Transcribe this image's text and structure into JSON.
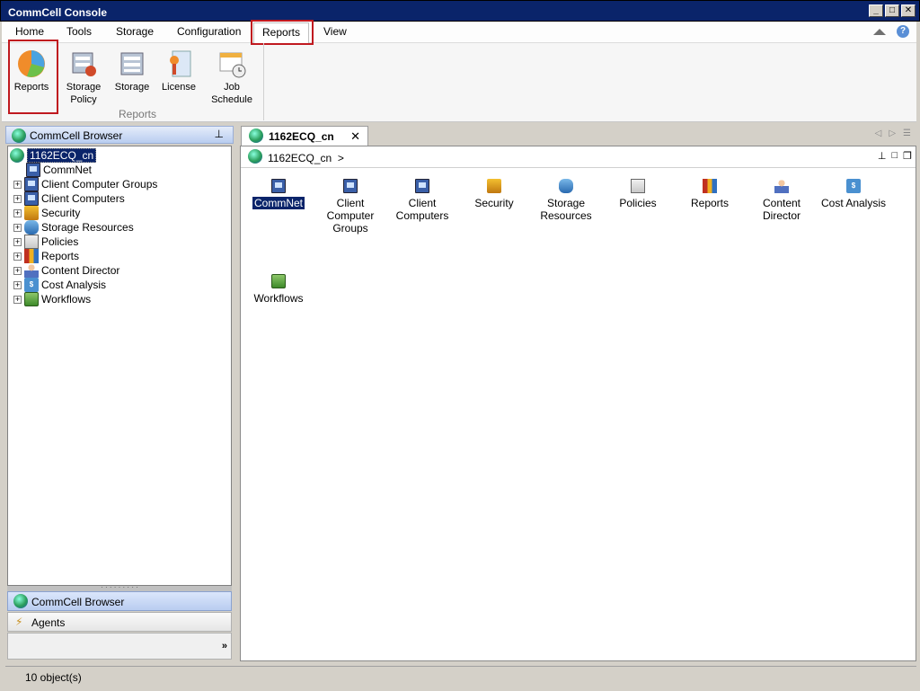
{
  "window": {
    "title": "CommCell Console"
  },
  "ribbon": {
    "tabs": [
      "Home",
      "Tools",
      "Storage",
      "Configuration",
      "Reports",
      "View"
    ],
    "active_tab": "Reports",
    "buttons": [
      {
        "label": "Reports",
        "icon": "pie-chart-icon"
      },
      {
        "label": "Storage Policy",
        "icon": "storage-policy-icon"
      },
      {
        "label": "Storage",
        "icon": "storage-icon"
      },
      {
        "label": "License",
        "icon": "license-icon"
      },
      {
        "label": "Job Schedule",
        "icon": "calendar-clock-icon"
      }
    ],
    "group_label": "Reports"
  },
  "left_panel": {
    "header": "CommCell Browser",
    "tree": {
      "root": "1162ECQ_cn",
      "children": [
        "CommNet",
        "Client Computer Groups",
        "Client Computers",
        "Security",
        "Storage Resources",
        "Policies",
        "Reports",
        "Content Director",
        "Cost Analysis",
        "Workflows"
      ]
    },
    "bottom_buttons": [
      "CommCell Browser",
      "Agents"
    ]
  },
  "right_panel": {
    "tab_title": "1162ECQ_cn",
    "breadcrumb": "1162ECQ_cn  >",
    "items": [
      "CommNet",
      "Client Computer Groups",
      "Client Computers",
      "Security",
      "Storage Resources",
      "Policies",
      "Reports",
      "Content Director",
      "Cost Analysis",
      "Workflows"
    ],
    "items_display": [
      [
        "CommNet"
      ],
      [
        "Client",
        "Computer",
        "Groups"
      ],
      [
        "Client",
        "Computers"
      ],
      [
        "Security"
      ],
      [
        "Storage",
        "Resources"
      ],
      [
        "Policies"
      ],
      [
        "Reports"
      ],
      [
        "Content",
        "Director"
      ],
      [
        "Cost Analysis"
      ],
      [
        "Workflows"
      ]
    ]
  },
  "status": {
    "text": "10 object(s)"
  }
}
